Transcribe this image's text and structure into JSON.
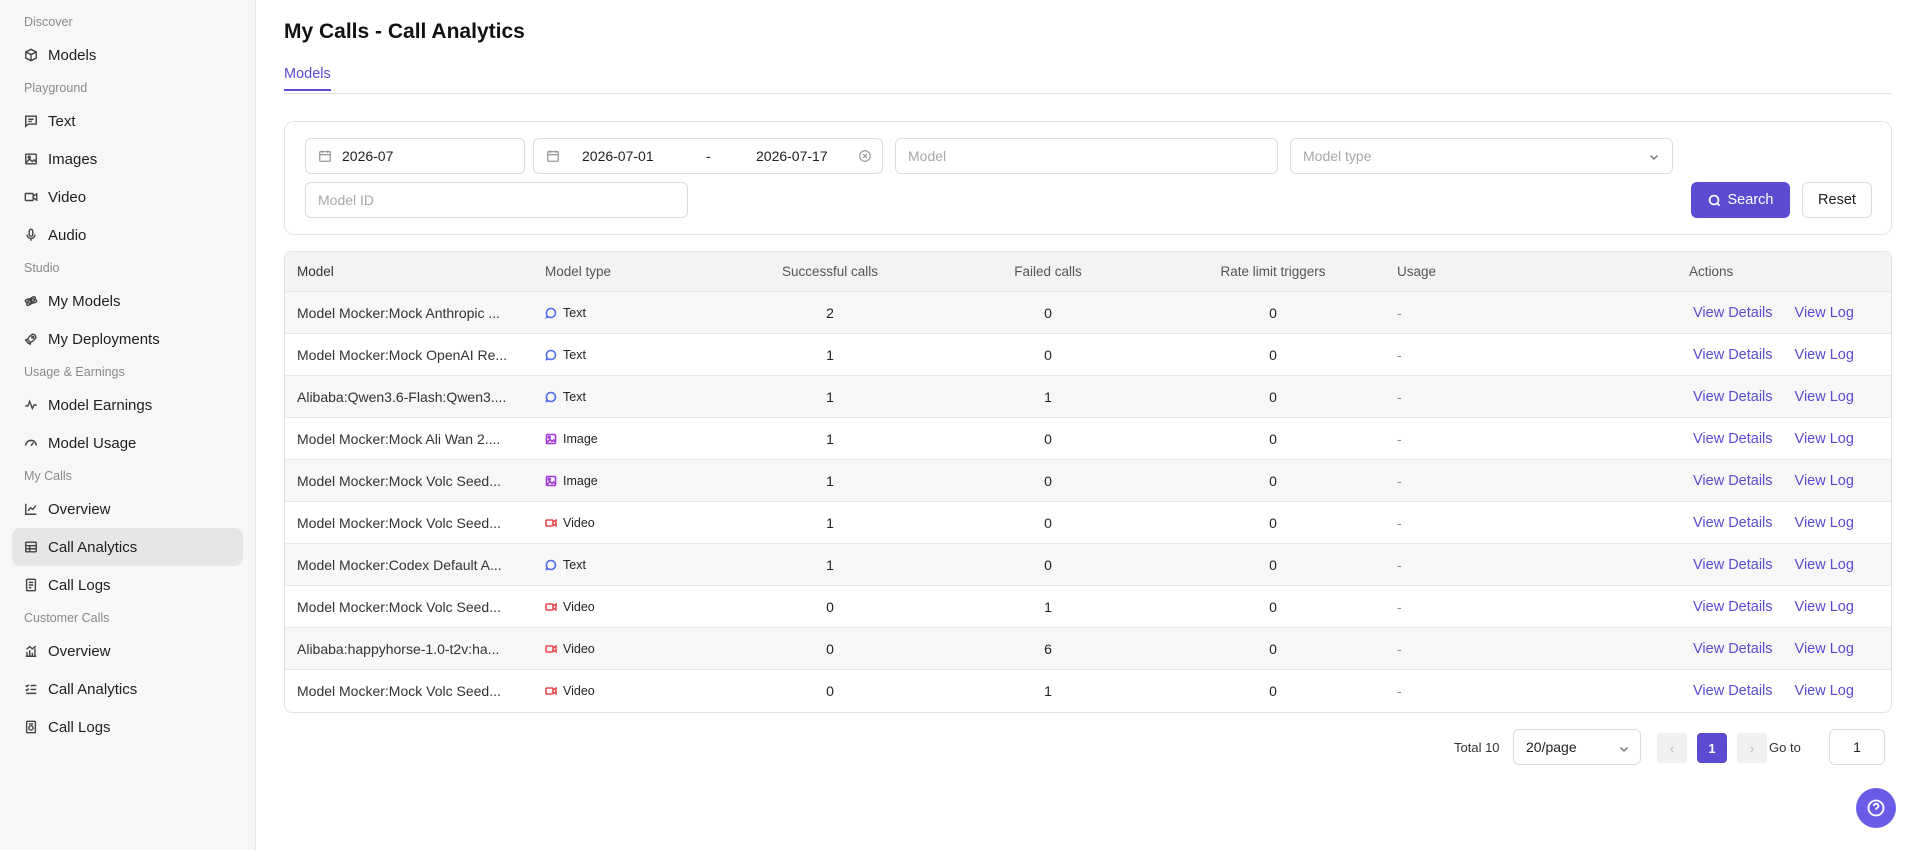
{
  "sidebar": {
    "sections": [
      {
        "title": "Discover",
        "items": [
          {
            "label": "Models",
            "icon": "cube-icon"
          }
        ]
      },
      {
        "title": "Playground",
        "items": [
          {
            "label": "Text",
            "icon": "message-square-icon"
          },
          {
            "label": "Images",
            "icon": "image-icon"
          },
          {
            "label": "Video",
            "icon": "video-icon"
          },
          {
            "label": "Audio",
            "icon": "mic-icon"
          }
        ]
      },
      {
        "title": "Studio",
        "items": [
          {
            "label": "My Models",
            "icon": "atom-icon"
          },
          {
            "label": "My Deployments",
            "icon": "rocket-icon"
          }
        ]
      },
      {
        "title": "Usage & Earnings",
        "items": [
          {
            "label": "Model Earnings",
            "icon": "activity-icon"
          },
          {
            "label": "Model Usage",
            "icon": "gauge-icon"
          }
        ]
      },
      {
        "title": "My Calls",
        "items": [
          {
            "label": "Overview",
            "icon": "line-chart-icon"
          },
          {
            "label": "Call Analytics",
            "icon": "table-icon",
            "active": true
          },
          {
            "label": "Call Logs",
            "icon": "log-icon"
          }
        ]
      },
      {
        "title": "Customer Calls",
        "items": [
          {
            "label": "Overview",
            "icon": "bar-line-chart-icon"
          },
          {
            "label": "Call Analytics",
            "icon": "list-checks-icon"
          },
          {
            "label": "Call Logs",
            "icon": "log-ring-icon"
          }
        ]
      }
    ]
  },
  "header": {
    "title": "My Calls - Call Analytics"
  },
  "tabs": [
    {
      "label": "Models"
    }
  ],
  "filters": {
    "month_value": "2026-07",
    "date_start": "2026-07-01",
    "date_sep": "-",
    "date_end": "2026-07-17",
    "model_placeholder": "Model",
    "model_type_placeholder": "Model type",
    "model_id_placeholder": "Model ID",
    "search_label": "Search",
    "reset_label": "Reset"
  },
  "table": {
    "columns": {
      "model": "Model",
      "model_type": "Model type",
      "successful": "Successful calls",
      "failed": "Failed calls",
      "rate_limit": "Rate limit triggers",
      "usage": "Usage",
      "actions": "Actions"
    },
    "action_labels": {
      "details": "View Details",
      "log": "View Log"
    },
    "rows": [
      {
        "model": "Model Mocker:Mock Anthropic ...",
        "type": "Text",
        "successful": "2",
        "failed": "0",
        "rate_limit": "0",
        "usage": "-"
      },
      {
        "model": "Model Mocker:Mock OpenAI Re...",
        "type": "Text",
        "successful": "1",
        "failed": "0",
        "rate_limit": "0",
        "usage": "-"
      },
      {
        "model": "Alibaba:Qwen3.6-Flash:Qwen3....",
        "type": "Text",
        "successful": "1",
        "failed": "1",
        "rate_limit": "0",
        "usage": "-"
      },
      {
        "model": "Model Mocker:Mock Ali Wan 2....",
        "type": "Image",
        "successful": "1",
        "failed": "0",
        "rate_limit": "0",
        "usage": "-"
      },
      {
        "model": "Model Mocker:Mock Volc Seed...",
        "type": "Image",
        "successful": "1",
        "failed": "0",
        "rate_limit": "0",
        "usage": "-"
      },
      {
        "model": "Model Mocker:Mock Volc Seed...",
        "type": "Video",
        "successful": "1",
        "failed": "0",
        "rate_limit": "0",
        "usage": "-"
      },
      {
        "model": "Model Mocker:Codex Default A...",
        "type": "Text",
        "successful": "1",
        "failed": "0",
        "rate_limit": "0",
        "usage": "-"
      },
      {
        "model": "Model Mocker:Mock Volc Seed...",
        "type": "Video",
        "successful": "0",
        "failed": "1",
        "rate_limit": "0",
        "usage": "-"
      },
      {
        "model": "Alibaba:happyhorse-1.0-t2v:ha...",
        "type": "Video",
        "successful": "0",
        "failed": "6",
        "rate_limit": "0",
        "usage": "-"
      },
      {
        "model": "Model Mocker:Mock Volc Seed...",
        "type": "Video",
        "successful": "0",
        "failed": "1",
        "rate_limit": "0",
        "usage": "-"
      }
    ]
  },
  "pagination": {
    "total_label": "Total 10",
    "page_size": "20/page",
    "current_page": "1",
    "goto_label": "Go to",
    "goto_value": "1"
  },
  "colors": {
    "accent": "#5a4bd1",
    "text_type": "#4f6bed",
    "image_type": "#a23bd6",
    "video_type": "#e5484d"
  }
}
